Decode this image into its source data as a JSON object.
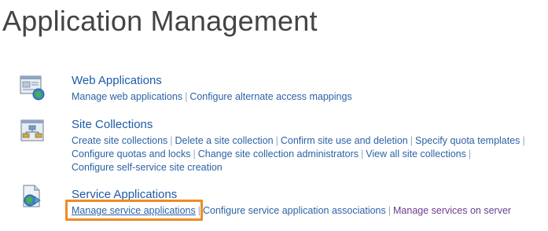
{
  "page": {
    "title": "Application Management"
  },
  "sections": [
    {
      "title": "Web Applications",
      "icon": "web-application-window-icon",
      "links": [
        "Manage web applications",
        "Configure alternate access mappings"
      ]
    },
    {
      "title": "Site Collections",
      "icon": "site-collection-hierarchy-icon",
      "links": [
        "Create site collections",
        "Delete a site collection",
        "Confirm site use and deletion",
        "Specify quota templates",
        "Configure quotas and locks",
        "Change site collection administrators",
        "View all site collections",
        "Configure self-service site creation"
      ]
    },
    {
      "title": "Service Applications",
      "icon": "service-application-page-globe-icon",
      "links": [
        "Manage service applications",
        "Configure service application associations",
        "Manage services on server"
      ]
    }
  ],
  "colors": {
    "link": "#2d62a6",
    "visited_link": "#6a3d8f",
    "highlight": "#f08a24",
    "title": "#444444"
  }
}
